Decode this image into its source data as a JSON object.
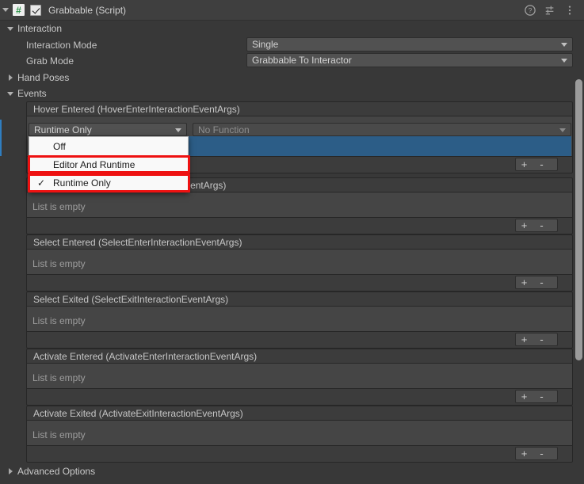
{
  "component": {
    "title": "Grabbable (Script)",
    "script_icon_glyph": "#",
    "enabled": true,
    "icons": {
      "help": "help-icon",
      "preset": "preset-icon",
      "menu": "kebab-menu-icon"
    }
  },
  "sections": {
    "interaction": {
      "label": "Interaction",
      "expanded": true
    },
    "hand_poses": {
      "label": "Hand Poses",
      "expanded": false
    },
    "events": {
      "label": "Events",
      "expanded": true
    },
    "advanced_options": {
      "label": "Advanced Options",
      "expanded": false
    }
  },
  "properties": [
    {
      "label": "Interaction Mode",
      "value": "Single"
    },
    {
      "label": "Grab Mode",
      "value": "Grabbable To Interactor"
    }
  ],
  "events": [
    {
      "title": "Hover Entered (HoverEnterInteractionEventArgs)",
      "has_entry": true,
      "entry": {
        "callback_state": "Runtime Only",
        "function": "No Function"
      },
      "empty_text": ""
    },
    {
      "title": "Hover Exited (HoverExitInteractionEventArgs)",
      "has_entry": false,
      "empty_text": "List is empty"
    },
    {
      "title": "Select Entered (SelectEnterInteractionEventArgs)",
      "has_entry": false,
      "empty_text": "List is empty"
    },
    {
      "title": "Select Exited (SelectExitInteractionEventArgs)",
      "has_entry": false,
      "empty_text": "List is empty"
    },
    {
      "title": "Activate Entered (ActivateEnterInteractionEventArgs)",
      "has_entry": false,
      "empty_text": "List is empty"
    },
    {
      "title": "Activate Exited (ActivateExitInteractionEventArgs)",
      "has_entry": false,
      "empty_text": "List is empty"
    }
  ],
  "list_buttons": {
    "add": "+",
    "remove": "-"
  },
  "popup_menu": {
    "open": true,
    "items": [
      {
        "label": "Off",
        "checked": false,
        "highlighted": false
      },
      {
        "label": "Editor And Runtime",
        "checked": false,
        "highlighted": true
      },
      {
        "label": "Runtime Only",
        "checked": true,
        "highlighted": true
      }
    ],
    "check_glyph": "✓"
  },
  "colors": {
    "window_bg": "#383838",
    "header_bg": "#3f3f3f",
    "field_bg": "#515151",
    "selection_blue": "#2c5d87",
    "accent_blue": "#2f7ec0",
    "highlight_red": "#ee1111",
    "menu_bg": "#f9f9f9",
    "script_icon_green": "#2b9348"
  }
}
